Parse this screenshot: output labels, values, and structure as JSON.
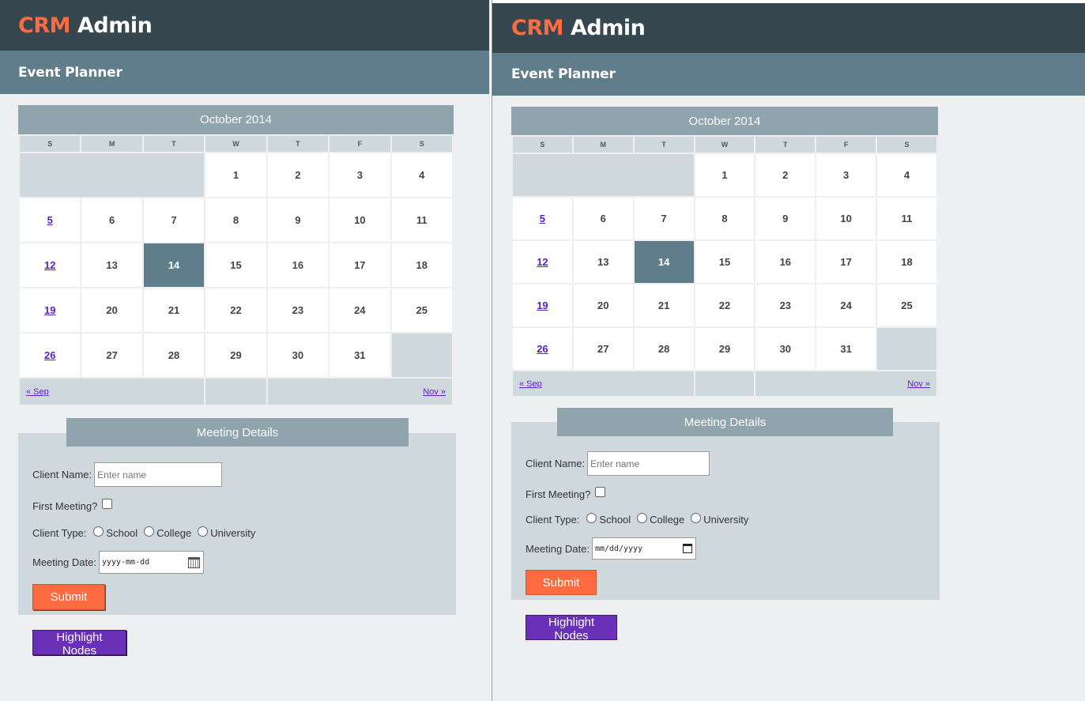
{
  "brand": {
    "crm": "CRM",
    "admin": "Admin"
  },
  "page_title": "Event Planner",
  "calendar": {
    "month_label": "October 2014",
    "weekdays": [
      "S",
      "M",
      "T",
      "W",
      "T",
      "F",
      "S"
    ],
    "weeks": [
      [
        "",
        "",
        "",
        "1",
        "2",
        "3",
        "4"
      ],
      [
        "5",
        "6",
        "7",
        "8",
        "9",
        "10",
        "11"
      ],
      [
        "12",
        "13",
        "14",
        "15",
        "16",
        "17",
        "18"
      ],
      [
        "19",
        "20",
        "21",
        "22",
        "23",
        "24",
        "25"
      ],
      [
        "26",
        "27",
        "28",
        "29",
        "30",
        "31",
        ""
      ]
    ],
    "selected_day": "14",
    "prev_link": "« Sep",
    "next_link": "Nov »"
  },
  "meeting": {
    "title": "Meeting Details",
    "client_name_label": "Client Name:",
    "client_name_placeholder": "Enter name",
    "first_meeting_label": "First Meeting?",
    "client_type_label": "Client Type:",
    "client_types": [
      "School",
      "College",
      "University"
    ],
    "meeting_date_label": "Meeting Date:",
    "date_placeholder_left": "yyyy-mm-dd",
    "date_placeholder_right": "mm/dd/yyyy",
    "submit_label": "Submit"
  },
  "highlight_label": "Highlight Nodes",
  "colors": {
    "header": "#37474f",
    "subheader": "#607d8b",
    "accent": "#ff6b40",
    "calendar_header": "#90a4ae",
    "panel": "#cfd8dc",
    "highlight_button": "#6a31b8",
    "link": "#5a1ec7"
  }
}
